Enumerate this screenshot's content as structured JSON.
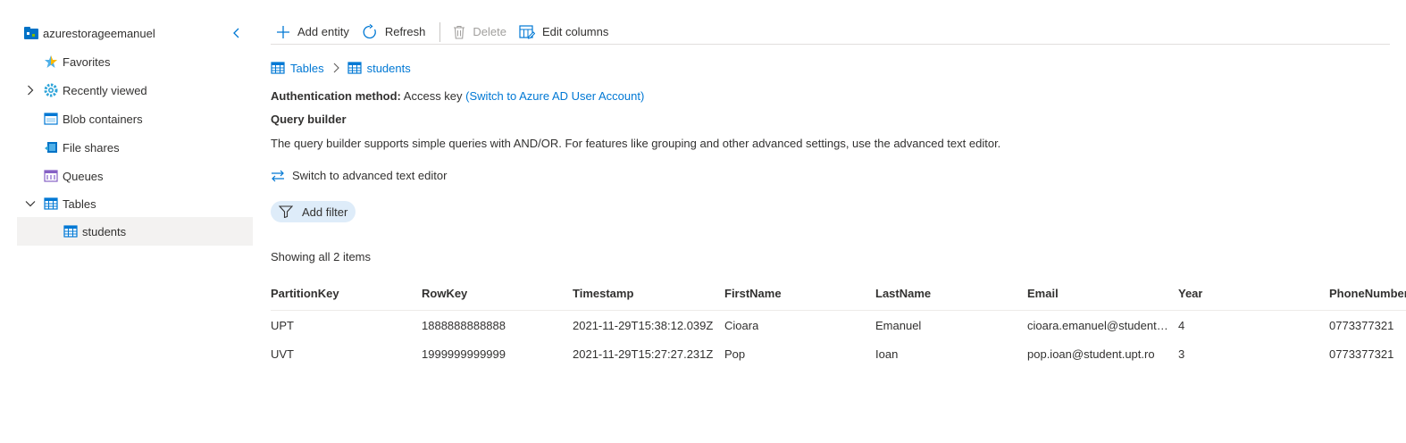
{
  "sidebar": {
    "account": "azurestorageemanuel",
    "items": [
      {
        "label": "Favorites"
      },
      {
        "label": "Recently viewed"
      },
      {
        "label": "Blob containers"
      },
      {
        "label": "File shares"
      },
      {
        "label": "Queues"
      },
      {
        "label": "Tables"
      },
      {
        "label": "students"
      }
    ]
  },
  "toolbar": {
    "add_entity": "Add entity",
    "refresh": "Refresh",
    "delete": "Delete",
    "edit_columns": "Edit columns"
  },
  "breadcrumb": {
    "root": "Tables",
    "current": "students"
  },
  "auth": {
    "label": "Authentication method:",
    "value": "Access key",
    "switch_link": "(Switch to Azure AD User Account)"
  },
  "query_builder": {
    "title": "Query builder",
    "description": "The query builder supports simple queries with AND/OR. For features like grouping and other advanced settings, use the advanced text editor.",
    "switch_editor": "Switch to advanced text editor",
    "add_filter": "Add filter"
  },
  "results": {
    "showing": "Showing all 2 items",
    "columns": [
      "PartitionKey",
      "RowKey",
      "Timestamp",
      "FirstName",
      "LastName",
      "Email",
      "Year",
      "PhoneNumber"
    ],
    "rows": [
      [
        "UPT",
        "1888888888888",
        "2021-11-29T15:38:12.039Z",
        "Cioara",
        "Emanuel",
        "cioara.emanuel@student.upt.ro",
        "4",
        "0773377321"
      ],
      [
        "UVT",
        "1999999999999",
        "2021-11-29T15:27:27.231Z",
        "Pop",
        "Ioan",
        "pop.ioan@student.upt.ro",
        "3",
        "0773377321"
      ]
    ]
  },
  "colors": {
    "accent": "#0078d4",
    "selected_bg": "#f3f2f1",
    "filter_bg": "#deecf9"
  }
}
